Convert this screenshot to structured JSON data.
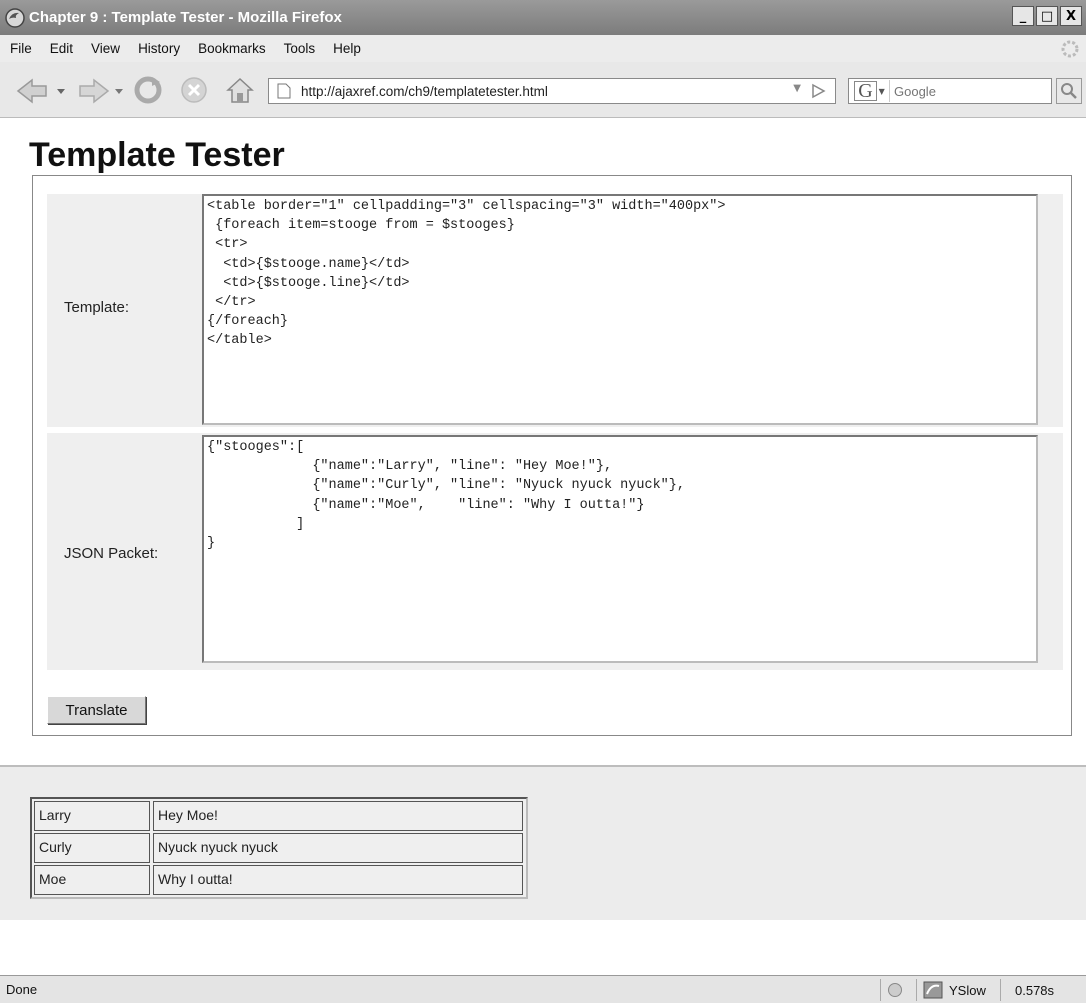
{
  "window": {
    "title": "Chapter 9 : Template Tester - Mozilla Firefox",
    "min_label": "_",
    "max_label": "□",
    "close_label": "X"
  },
  "menu": [
    {
      "label": "File"
    },
    {
      "label": "Edit"
    },
    {
      "label": "View"
    },
    {
      "label": "History"
    },
    {
      "label": "Bookmarks"
    },
    {
      "label": "Tools"
    },
    {
      "label": "Help"
    }
  ],
  "nav": {
    "url": "http://ajaxref.com/ch9/templatetester.html",
    "search_placeholder": "Google",
    "search_engine": "G"
  },
  "page": {
    "title": "Template Tester",
    "template_label": "Template:",
    "template_value": "<table border=\"1\" cellpadding=\"3\" cellspacing=\"3\" width=\"400px\">\n {foreach item=stooge from = $stooges}\n <tr>\n  <td>{$stooge.name}</td>\n  <td>{$stooge.line}</td>\n </tr>\n{/foreach}\n</table>",
    "json_label": "JSON Packet:",
    "json_value": "{\"stooges\":[\n             {\"name\":\"Larry\", \"line\": \"Hey Moe!\"},\n             {\"name\":\"Curly\", \"line\": \"Nyuck nyuck nyuck\"},\n             {\"name\":\"Moe\",    \"line\": \"Why I outta!\"}\n           ]\n}",
    "translate_label": "Translate"
  },
  "results": [
    {
      "name": "Larry",
      "line": "Hey Moe!"
    },
    {
      "name": "Curly",
      "line": "Nyuck nyuck nyuck"
    },
    {
      "name": "Moe",
      "line": "Why I outta!"
    }
  ],
  "status": {
    "text": "Done",
    "yslow_label": "YSlow",
    "load_time": "0.578s"
  }
}
